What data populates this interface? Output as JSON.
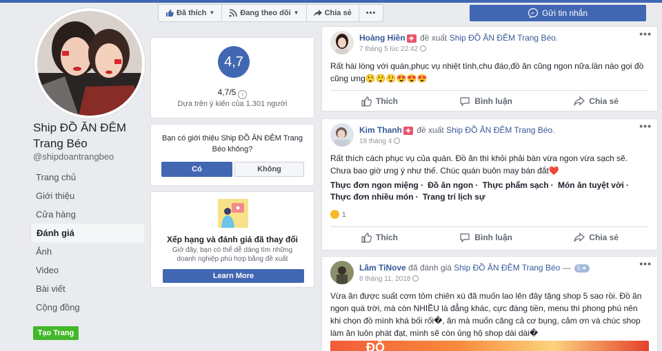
{
  "page": {
    "name": "Ship ĐỒ ĂN ĐÊM Trang Béo",
    "handle": "@shipdoantrangbeo",
    "nav": [
      "Trang chủ",
      "Giới thiệu",
      "Cửa hàng",
      "Đánh giá",
      "Ảnh",
      "Video",
      "Bài viết",
      "Cộng đồng"
    ],
    "active_nav": "Đánh giá",
    "create_page": "Tạo Trang"
  },
  "actionbar": {
    "liked": "Đã thích",
    "following": "Đang theo dõi",
    "share": "Chia sẻ",
    "more": "•••",
    "message": "Gửi tin nhắn"
  },
  "rating": {
    "score": "4,7",
    "score_text": "4,7/5",
    "info": "i",
    "based_on": "Dựa trên ý kiến của 1.301 người"
  },
  "recommend": {
    "question": "Bạn có giới thiệu Ship ĐỒ ĂN ĐÊM Trang Béo không?",
    "yes": "Có",
    "no": "Không"
  },
  "promo": {
    "title": "Xếp hạng và đánh giá đã thay đổi",
    "text": "Giờ đây, bạn có thể dễ dàng tìm những doanh nghiệp phù hợp bằng đề xuất",
    "button": "Learn More"
  },
  "reviews": [
    {
      "author": "Hoàng Hiền",
      "verb": "đề xuất",
      "page": "Ship ĐỒ ĂN ĐÊM Trang Béo",
      "page_suffix": ".",
      "time": "7 tháng 5 lúc 22:42",
      "text": "Rất hài lòng với quán,phục vụ nhiệt tình,chu đáo,đồ ăn cũng ngon nữa.lần nào gọi đồ cũng ưng😲😲😲😍😍😍"
    },
    {
      "author": "Kim Thanh",
      "verb": "đề xuất",
      "page": "Ship ĐỒ ĂN ĐÊM Trang Béo.",
      "time": "18 tháng 4",
      "text": "Rất thích cách phục vụ của quán. Đồ ăn thì khỏi phải bàn vừa ngon vừa sạch sẽ. Chưa bao giờ ưng ý như thế. Chúc quán buôn may bán đắt❤️",
      "tags": [
        "Thực đơn ngon miệng",
        "Đồ ăn ngon",
        "Thực phẩm sạch",
        "Món ăn tuyệt vời",
        "Thực đơn nhiều món",
        "Trang trí lịch sự"
      ],
      "tag_sep": "·",
      "reactions": "1"
    },
    {
      "author": "Lâm TiNove",
      "verb": "đã đánh giá",
      "page": "Ship ĐỒ ĂN ĐÊM Trang Béo",
      "page_suffix": " —",
      "badge": "5 ★",
      "time": "8 tháng 11, 2018",
      "text": "Vừa ăn được suất cơm tôm chiên xù đã muốn lao lên đây tặng shop 5 sao rồi. Đồ ăn ngon quá trời, mà còn NHIỀU là đẳng khác, cực đáng tiền, menu thì phong phú nên khi chọn đồ mình khá bối rối�, ăn mà muốn căng cả cơ bụng, cảm ơn và chúc shop làm ăn luôn phát đạt, mình sẽ còn ủng hộ shop dài dài�",
      "photo_text": "ĐỒ"
    }
  ],
  "post_actions": {
    "like": "Thích",
    "comment": "Bình luận",
    "share": "Chia sẻ"
  },
  "colors": {
    "brand": "#4267b2",
    "link": "#365899",
    "create": "#42b72a",
    "background": "#e9ebee"
  }
}
